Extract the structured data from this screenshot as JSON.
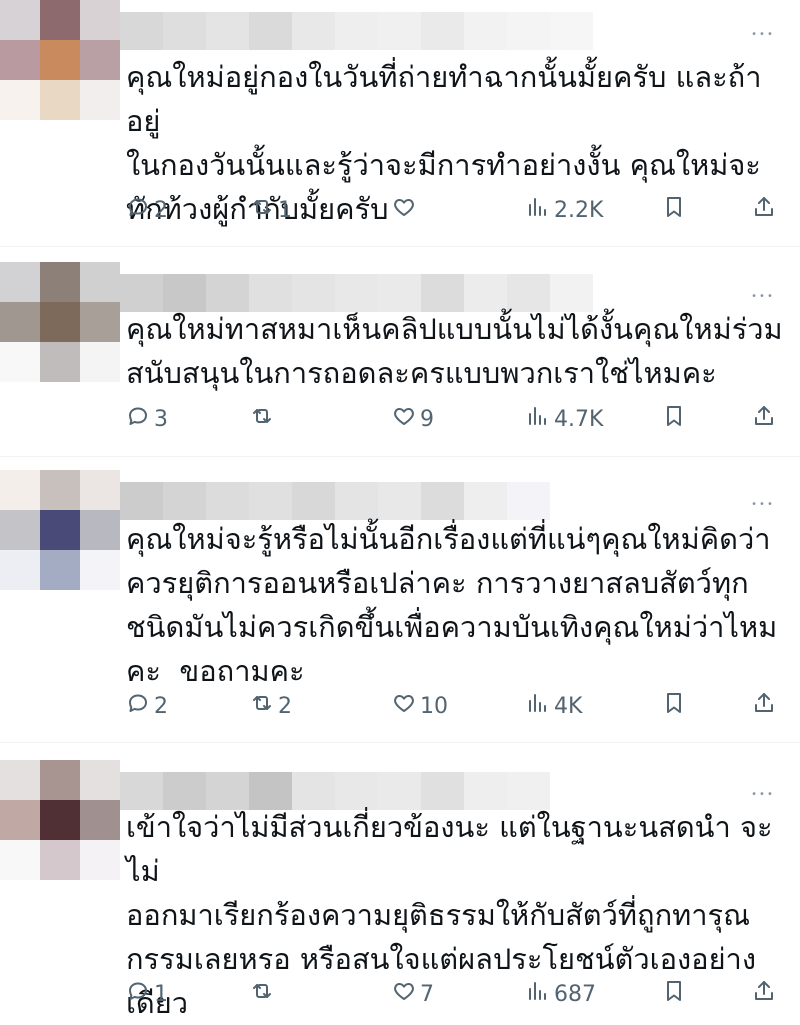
{
  "tweets": [
    {
      "text": "คุณใหม่อยู่กองในวันที่ถ่ายทำฉากนั้นมั้ยครับ และถ้าอยู่\nในกองวันนั้นและรู้ว่าจะมีการทำอย่างงั้น คุณใหม่จะ\nทักท้วงผู้กำกับมั้ยครับ",
      "replies": "2",
      "reposts": "1",
      "likes": "",
      "views": "2.2K",
      "avatar_colors": [
        "#d6d2d6",
        "#8c6a6e",
        "#d8d2d4",
        "#b89aa0",
        "#c98a5e",
        "#b8a0a4",
        "#f8f2ee",
        "#e8d8c4",
        "#f2eeee"
      ],
      "name_colors": [
        "#d8d8d8",
        "#dedede",
        "#e4e4e4",
        "#dadada",
        "#e8e8e8",
        "#eeeeee",
        "#f0f0f0",
        "#eaeaea",
        "#f2f2f2",
        "#f4f4f4",
        "#f6f6f6"
      ]
    },
    {
      "text": "คุณใหม่ทาสหมาเห็นคลิปแบบนั้นไม่ได้งั้นคุณใหม่ร่วม\nสนับสนุนในการถอดละครแบบพวกเราใช่ไหมคะ",
      "replies": "3",
      "reposts": "",
      "likes": "9",
      "views": "4.7K",
      "avatar_colors": [
        "#d2d2d4",
        "#8c8078",
        "#d0d0d0",
        "#a09890",
        "#7e6a5a",
        "#a8a098",
        "#f8f8f8",
        "#c0bcbc",
        "#f4f4f4"
      ],
      "name_colors": [
        "#d0d0d0",
        "#c8c8c8",
        "#d4d4d4",
        "#e0e0e0",
        "#e4e4e4",
        "#e8e8e8",
        "#eaeaea",
        "#dcdcdc",
        "#ececec",
        "#e6e6e6",
        "#f2f2f2"
      ]
    },
    {
      "text": "คุณใหม่จะรู้หรือไม่นั้นอีกเรื่องแต่ที่แน่ๆคุณใหม่คิดว่า\nควรยุติการออนหรือเปล่าคะ การวางยาสลบสัตว์ทุก\nชนิดมันไม่ควรเกิดขึ้นเพื่อความบันเทิงคุณใหม่ว่าไหม\nคะ  ขอถามคะ",
      "replies": "2",
      "reposts": "2",
      "likes": "10",
      "views": "4K",
      "avatar_colors": [
        "#f4eeea",
        "#c8c0bc",
        "#ebe6e4",
        "#c4c4c8",
        "#4a4a78",
        "#b8b8c0",
        "#eceef4",
        "#a4acc4",
        "#f4f4f8"
      ],
      "name_colors": [
        "#cccccc",
        "#d4d4d4",
        "#dcdcdc",
        "#e0e0e0",
        "#d8d8d8",
        "#e4e4e4",
        "#e8e8e8",
        "#dcdcdc",
        "#eeeeee",
        "#f4f4f8"
      ]
    },
    {
      "text": "เข้าใจว่าไม่มีส่วนเกี่ยวข้องนะ แต่ในฐานะนสดนำ จะไม่\nออกมาเรียกร้องความยุติธรรมให้กับสัตว์ที่ถูกทารุณ\nกรรมเลยหรอ หรือสนใจแต่ผลประโยชน์ตัวเองอย่าง\nเดียว",
      "replies": "1",
      "reposts": "",
      "likes": "7",
      "views": "687",
      "avatar_colors": [
        "#e4e0e0",
        "#a89490",
        "#e4e0e0",
        "#c0a8a4",
        "#503034",
        "#a09090",
        "#f8f8f8",
        "#d4c8cc",
        "#f4f2f4"
      ],
      "name_colors": [
        "#d8d8d8",
        "#cccccc",
        "#d4d4d4",
        "#c4c4c4",
        "#e4e4e4",
        "#e8e8e8",
        "#eaeaea",
        "#e0e0e0",
        "#eeeeee",
        "#f0f0f0"
      ]
    }
  ]
}
